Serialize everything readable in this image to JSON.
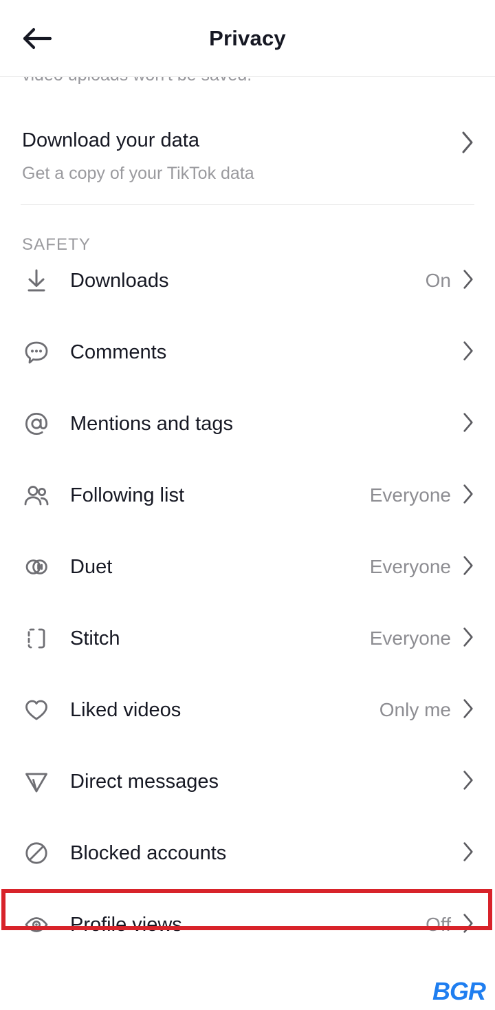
{
  "header": {
    "title": "Privacy",
    "back_icon": "arrow-left-icon"
  },
  "clipped_text": "video uploads won't be saved.",
  "data_row": {
    "title": "Download your data",
    "subtitle": "Get a copy of your TikTok data",
    "chevron_icon": "chevron-right-icon"
  },
  "safety": {
    "section_label": "SAFETY",
    "items": [
      {
        "label": "Downloads",
        "value": "On",
        "icon": "download-icon"
      },
      {
        "label": "Comments",
        "value": "",
        "icon": "comment-bubble-icon"
      },
      {
        "label": "Mentions and tags",
        "value": "",
        "icon": "at-sign-icon"
      },
      {
        "label": "Following list",
        "value": "Everyone",
        "icon": "people-icon"
      },
      {
        "label": "Duet",
        "value": "Everyone",
        "icon": "duet-icon"
      },
      {
        "label": "Stitch",
        "value": "Everyone",
        "icon": "stitch-icon"
      },
      {
        "label": "Liked videos",
        "value": "Only me",
        "icon": "heart-icon"
      },
      {
        "label": "Direct messages",
        "value": "",
        "icon": "send-icon"
      },
      {
        "label": "Blocked accounts",
        "value": "",
        "icon": "block-icon"
      },
      {
        "label": "Profile views",
        "value": "Off",
        "icon": "eye-icon"
      }
    ]
  },
  "highlight": {
    "target_label": "Profile views",
    "color": "#d8232a"
  },
  "watermark": {
    "text": "BGR",
    "color": "#1f7ef0"
  },
  "colors": {
    "text_primary": "#161823",
    "text_secondary": "#9a9a9e",
    "icon": "#6e6e73",
    "divider": "#e9e9e9",
    "background": "#ffffff"
  }
}
